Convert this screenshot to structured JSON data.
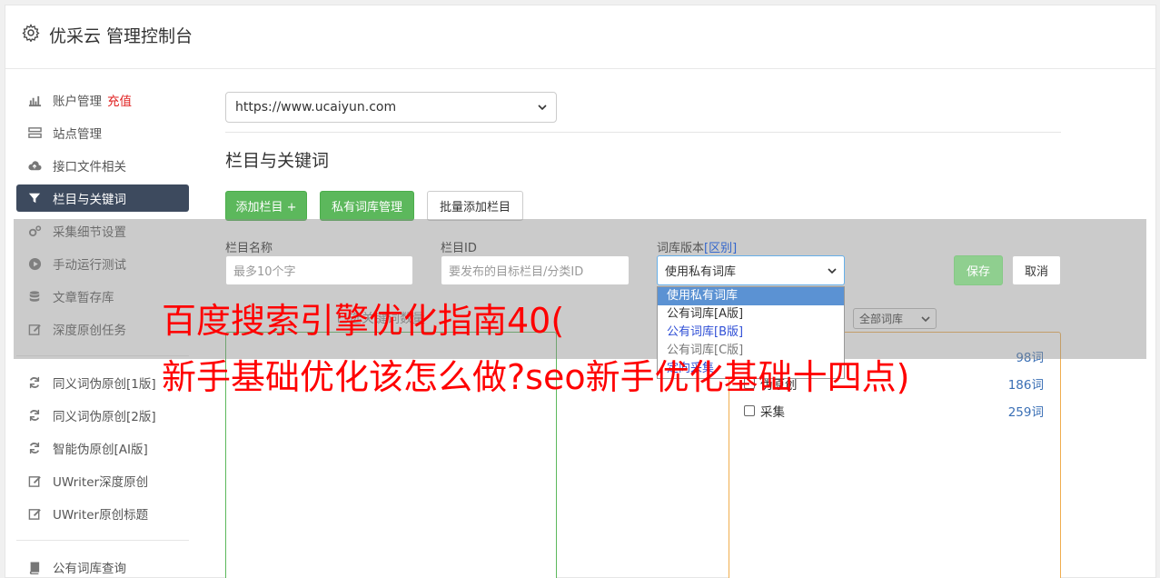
{
  "header": {
    "title": "优采云 管理控制台",
    "icon": "gear-icon"
  },
  "sidebar": {
    "items": [
      {
        "label": "账户管理",
        "icon": "bar-chart-icon",
        "badge": "充值"
      },
      {
        "label": "站点管理",
        "icon": "server-icon"
      },
      {
        "label": "接口文件相关",
        "icon": "cloud-upload-icon"
      },
      {
        "label": "栏目与关键词",
        "icon": "filter-icon",
        "active": true
      },
      {
        "label": "采集细节设置",
        "icon": "gears-icon"
      },
      {
        "label": "手动运行测试",
        "icon": "play-circle-icon"
      },
      {
        "label": "文章暂存库",
        "icon": "database-icon"
      },
      {
        "label": "深度原创任务",
        "icon": "edit-icon"
      }
    ],
    "items2": [
      {
        "label": "同义词伪原创[1版]",
        "icon": "refresh-icon"
      },
      {
        "label": "同义词伪原创[2版]",
        "icon": "refresh-icon"
      },
      {
        "label": "智能伪原创[AI版]",
        "icon": "refresh-icon"
      },
      {
        "label": "UWriter深度原创",
        "icon": "edit-icon"
      },
      {
        "label": "UWriter原创标题",
        "icon": "edit-icon"
      }
    ],
    "items3": [
      {
        "label": "公有词库查询",
        "icon": "book-icon"
      }
    ]
  },
  "main": {
    "site_select": "https://www.ucaiyun.com",
    "section_title": "栏目与关键词",
    "buttons": {
      "add_column": "添加栏目 +",
      "private_lib": "私有词库管理",
      "batch_add": "批量添加栏目"
    },
    "form": {
      "name_label": "栏目名称",
      "name_placeholder": "最多10个字",
      "id_label": "栏目ID",
      "id_placeholder": "要发布的目标栏目/分类ID",
      "version_label": "词库版本",
      "version_link": "[区别]",
      "version_value": "使用私有词库",
      "save": "保存",
      "cancel": "取消"
    },
    "dropdown_options": [
      "使用私有词库",
      "公有词库[A版]",
      "公有词库[B版]",
      "公有词库[C版]",
      "定向采集"
    ],
    "faint_label": "已选关键词数量",
    "lib_filter": "全部词库",
    "libraries": [
      {
        "name": "",
        "count": "98词"
      },
      {
        "name": "伪原创",
        "count": "186词"
      },
      {
        "name": "采集",
        "count": "259词"
      }
    ]
  },
  "watermark": {
    "line1": "百度搜索引擎优化指南40(",
    "line2": "新手基础优化该怎么做?seo新手优化基础十四点)"
  }
}
